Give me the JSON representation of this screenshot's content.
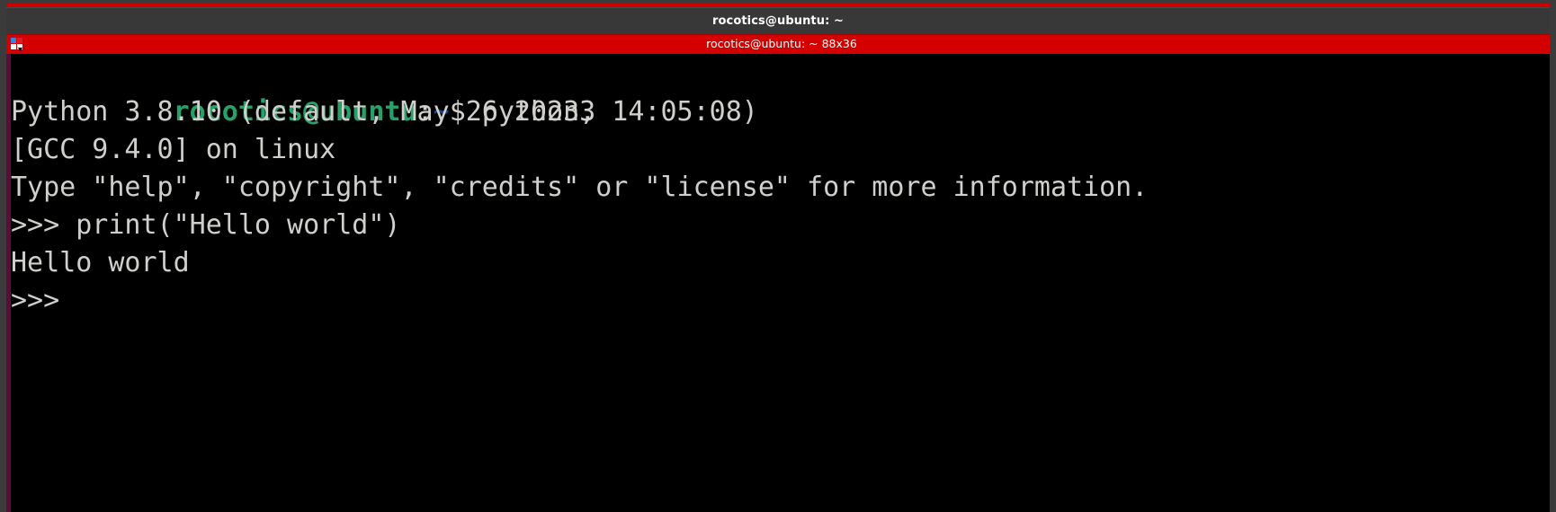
{
  "window": {
    "title": "rocotics@ubuntu: ~",
    "accent_color": "#cc0000",
    "titlebar_color": "#383838"
  },
  "tabbar": {
    "label": "rocotics@ubuntu: ~ 88x36",
    "background_color": "#d40000",
    "menu_icon": "tab-menu-icon"
  },
  "terminal": {
    "background_color": "#000000",
    "foreground_color": "#d0cfcc",
    "prompt": {
      "user_host": "rocotics@ubuntu",
      "colon": ":",
      "path": "~",
      "dollar": "$",
      "user_host_color": "#26a269",
      "path_color": "#12488b"
    },
    "lines": [
      {
        "type": "prompt",
        "command": " python3"
      },
      {
        "type": "plain",
        "text": "Python 3.8.10 (default, May 26 2023, 14:05:08)"
      },
      {
        "type": "plain",
        "text": "[GCC 9.4.0] on linux"
      },
      {
        "type": "plain",
        "text": "Type \"help\", \"copyright\", \"credits\" or \"license\" for more information."
      },
      {
        "type": "plain",
        "text": ">>> print(\"Hello world\")"
      },
      {
        "type": "plain",
        "text": "Hello world"
      },
      {
        "type": "plain",
        "text": ">>> "
      }
    ]
  }
}
